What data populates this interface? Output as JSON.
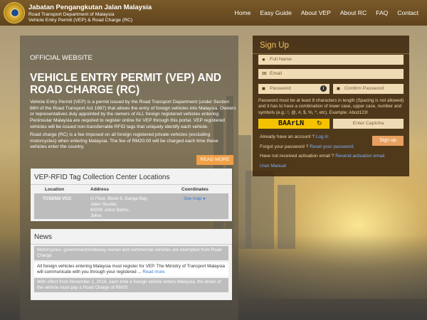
{
  "header": {
    "title": "Jabatan Pengangkutan Jalan Malaysia",
    "subtitle1": "Road Transport Department of Malaysia",
    "subtitle2": "Vehicle Entry Permit (VEP) & Road Charge (RC)",
    "nav": [
      "Home",
      "Easy Guide",
      "About VEP",
      "About RC",
      "FAQ",
      "Contact"
    ]
  },
  "main": {
    "official_label": "OFFICIAL WEBSITE",
    "headline": "VEHICLE ENTRY PERMIT (VEP) AND ROAD CHARGE (RC)",
    "intro1": "Vehicle Entry Permit (VEP) is a permit issued by the Road Transport Department (under Section 66H of the Road Transport Act 1987) that allows the entry of foreign vehicles into Malaysia. Owners or representatives duly appointed by the owners of ALL foreign registered vehicles entering Peninsular Malaysia are required to register online for VEP through this portal. VEP registered vehicles will be issued non-transferrable RFID tags that uniquely identify each vehicle.",
    "intro2": "Road charge (RC) is a fee imposed on all foreign registered private vehicles (excluding motorcycles) when entering Malaysia. The fee of RM20.00 will be charged each time these vehicles enter the country.",
    "read_more": "READ MORE"
  },
  "vep_centers": {
    "title": "VEP-RFID Tag Collection Center Locations",
    "headers": [
      "Location",
      "Address",
      "Coordinates"
    ],
    "rows": [
      {
        "location": "TCSENS VCC",
        "address_lines": [
          "G Floor, Block 6, Danga Bay,",
          "Jalan Skudai,",
          "80200 Johor Bahru,",
          "Johor."
        ],
        "coordinates": "See map"
      }
    ]
  },
  "news": {
    "title": "News",
    "items": [
      "Motorcycles, government/embassy owned and commercial vehicles are exempted from Road Charge.",
      "All foreign vehicles entering Malaysia must register for VEP. The Ministry of Transport Malaysia will communicate with you through your registered ...",
      "With effect from November 1, 2016, each time a foreign vehicle enters Malaysia, the driver of the vehicle must pay a Road Charge of RM20."
    ],
    "read_more": "Read more"
  },
  "signup": {
    "title": "Sign Up",
    "full_name_ph": "Full Name",
    "email_ph": "Email",
    "password_ph": "Password",
    "confirm_ph": "Confirm Password",
    "password_note": "Password must be at least 8 characters in length (Spacing is not allowed) and it has to have a combination of lower case, upper case, number and symbols (e.g.: !, @, #, $, %, ^, etc). Example: Abcd123!",
    "captcha_code": "BAArLN",
    "captcha_ph": "Enter Captcha",
    "button": "Sign up",
    "have_account": "Already have an account ?",
    "login": "Log in",
    "forgot": "Forgot your password ?",
    "reset": "Reset your password.",
    "no_activation": "Have not received activation email ?",
    "resend": "Resend activation email",
    "manual": "User Manual"
  },
  "colors": {
    "header_bg": "#6a4c22",
    "signup_bg": "#3e280e",
    "accent_orange": "#f0a048",
    "captcha_yellow": "#f5c200",
    "link_blue": "#3a7bd5"
  },
  "icons": [
    "user-icon",
    "envelope-icon",
    "lock-icon",
    "info-icon",
    "refresh-icon",
    "map-marker-icon"
  ]
}
